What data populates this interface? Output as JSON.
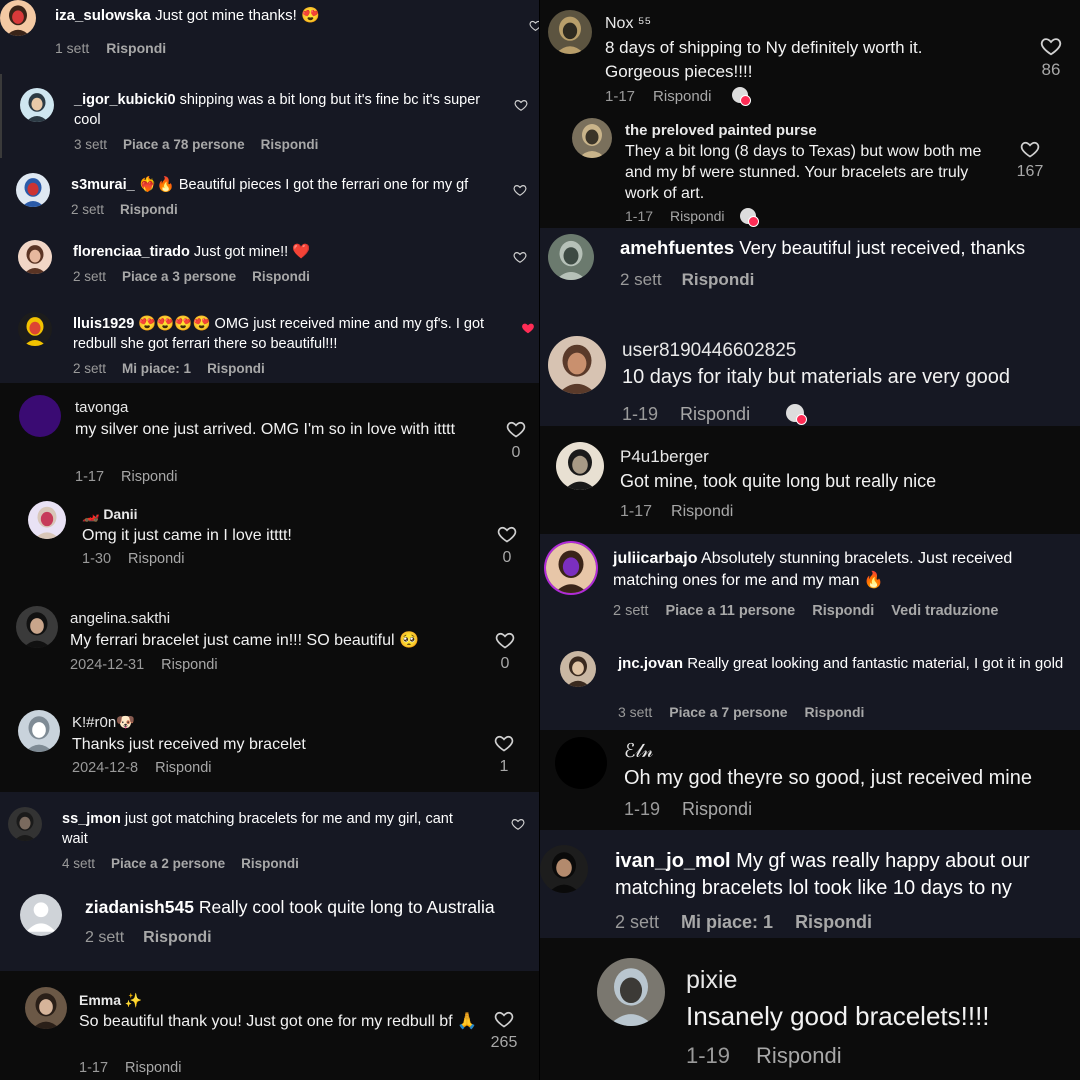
{
  "colors": {
    "dark": "#161823",
    "black": "#0c0c0c",
    "meta": "#9a9a9a",
    "like_red": "#fe2c55"
  },
  "left": [
    {
      "user": "iza_sulowska",
      "text": "Just got mine thanks! 😍",
      "time": "1 sett",
      "reply": "Rispondi"
    },
    {
      "user": "_igor_kubicki0",
      "text": "shipping was a bit long but it's fine bc it's super cool",
      "time": "3 sett",
      "likes": "Piace a 78 persone",
      "reply": "Rispondi"
    },
    {
      "user": "s3murai_",
      "text": "❤️‍🔥🔥 Beautiful pieces I got the ferrari one for my gf",
      "time": "2 sett",
      "reply": "Rispondi"
    },
    {
      "user": "florenciaa_tirado",
      "text": "Just got mine!! ❤️",
      "time": "2 sett",
      "likes": "Piace a 3 persone",
      "reply": "Rispondi"
    },
    {
      "user": "lluis1929",
      "text": "😍😍😍😍 OMG just received mine and my gf's. I got redbull she got ferrari there so beautiful!!!",
      "time": "2 sett",
      "likes": "Mi piace: 1",
      "reply": "Rispondi"
    },
    {
      "user": "tavonga",
      "text": "my silver one just arrived. OMG I'm so in love with itttt",
      "time": "1-17",
      "reply": "Rispondi",
      "count": "0"
    },
    {
      "user": "🏎️ Danii",
      "text": "Omg it just came in I love itttt!",
      "time": "1-30",
      "reply": "Rispondi",
      "count": "0"
    },
    {
      "user": "angelina.sakthi",
      "text": "My ferrari bracelet just came in!!! SO beautiful 🥺",
      "time": "2024-12-31",
      "reply": "Rispondi",
      "count": "0"
    },
    {
      "user": "K!#r0n🐶",
      "text": "Thanks just received my bracelet",
      "time": "2024-12-8",
      "reply": "Rispondi",
      "count": "1"
    },
    {
      "user": "ss_jmon",
      "text": "just got matching bracelets for me and my girl, cant wait",
      "time": "4 sett",
      "likes": "Piace a 2 persone",
      "reply": "Rispondi"
    },
    {
      "user": "ziadanish545",
      "text": "Really cool took quite long to Australia",
      "time": "2 sett",
      "reply": "Rispondi"
    },
    {
      "user": "Emma ✨",
      "text": "So beautiful thank you! Just got one for my redbull bf 🙏",
      "time": "1-17",
      "reply": "Rispondi",
      "count": "265"
    }
  ],
  "right": [
    {
      "user": "Nox ⁵⁵",
      "text": "8 days of shipping to Ny definitely worth it. Gorgeous pieces!!!!",
      "time": "1-17",
      "reply": "Rispondi",
      "count": "86"
    },
    {
      "user": "the preloved painted purse",
      "text": "They a bit long (8 days to Texas) but wow both me and my bf were stunned. Your bracelets are truly work of art.",
      "time": "1-17",
      "reply": "Rispondi",
      "count": "167"
    },
    {
      "user": "amehfuentes",
      "text": "Very beautiful just received, thanks",
      "time": "2 sett",
      "reply": "Rispondi"
    },
    {
      "user": "user8190446602825",
      "text": "10 days for italy but materials are very good",
      "time": "1-19",
      "reply": "Rispondi"
    },
    {
      "user": "P4u1berger",
      "text": "Got mine, took quite long but really nice",
      "time": "1-17",
      "reply": "Rispondi"
    },
    {
      "user": "juliicarbajo",
      "text": "Absolutely stunning bracelets. Just received matching ones for me and my man 🔥",
      "time": "2 sett",
      "likes": "Piace a 11 persone",
      "reply": "Rispondi",
      "translate": "Vedi traduzione"
    },
    {
      "user": "jnc.jovan",
      "text": "Really great looking and fantastic material, I got it in gold",
      "time": "3 sett",
      "likes": "Piace a 7 persone",
      "reply": "Rispondi"
    },
    {
      "user": "ℰ𝓁𝓃",
      "text": "Oh my god theyre so good, just received mine",
      "time": "1-19",
      "reply": "Rispondi"
    },
    {
      "user": "ivan_jo_mol",
      "text": "My gf was really happy about our matching bracelets lol took like 10 days to ny",
      "time": "2 sett",
      "likes": "Mi piace: 1",
      "reply": "Rispondi"
    },
    {
      "user": "pixie",
      "text": "Insanely good bracelets!!!!",
      "time": "1-19",
      "reply": "Rispondi"
    }
  ]
}
